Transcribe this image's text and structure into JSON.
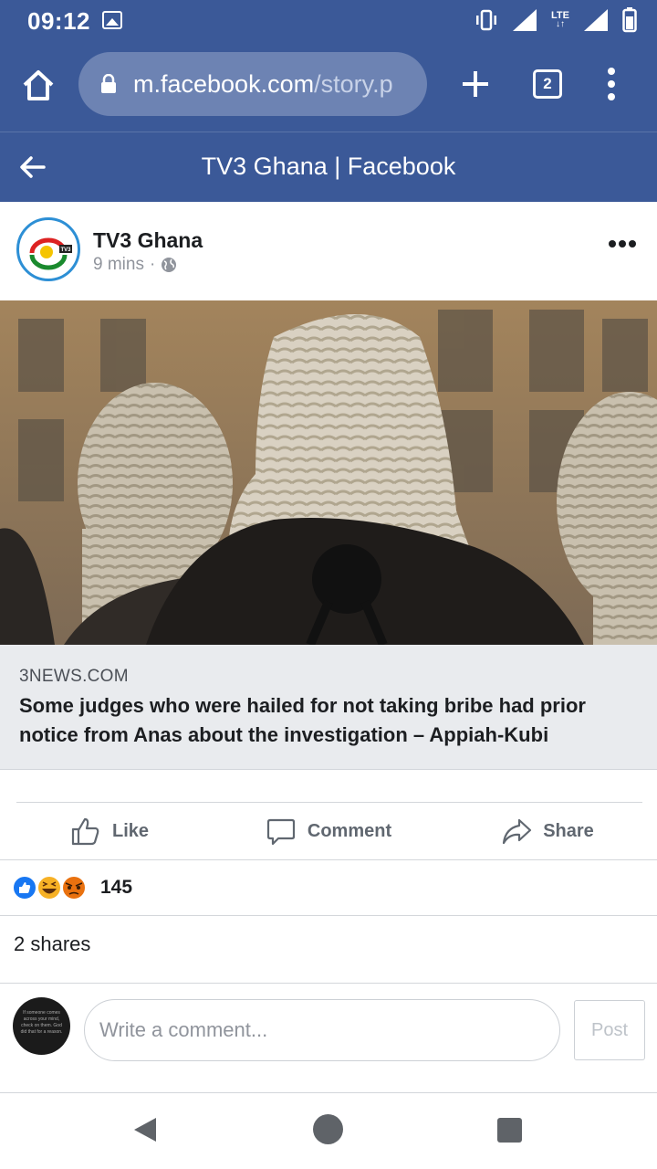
{
  "status_bar": {
    "time": "09:12",
    "network_label": "LTE",
    "icons": [
      "image-icon",
      "vibrate-icon",
      "signal-icon",
      "lte-signal-icon",
      "battery-icon"
    ]
  },
  "browser": {
    "url_domain": "m.facebook.com",
    "url_path": "/story.p",
    "tab_count": "2",
    "icons": [
      "home-icon",
      "lock-icon",
      "plus-icon",
      "tabs-icon",
      "overflow-menu-icon"
    ]
  },
  "header": {
    "title": "TV3 Ghana | Facebook",
    "back_icon": "arrow-left-icon"
  },
  "post": {
    "page_name": "TV3 Ghana",
    "time_ago": "9 mins",
    "separator": "·",
    "privacy_icon": "globe-icon",
    "more_icon": "more-dots-icon",
    "avatar_logo_text": "TV3",
    "image_desc_icon": "photo",
    "link": {
      "domain": "3NEWS.COM",
      "title": "Some judges who were hailed for not taking bribe had prior notice from Anas about the investigation – Appiah-Kubi"
    }
  },
  "actions": {
    "like": "Like",
    "comment": "Comment",
    "share": "Share"
  },
  "reactions": {
    "count": "145",
    "types": [
      "like",
      "haha",
      "angry"
    ]
  },
  "shares": {
    "text": "2 shares"
  },
  "composer": {
    "placeholder": "Write a comment...",
    "post_label": "Post",
    "avatar_text": "If someone comes across your mind, check on them. God did that for a reason."
  },
  "colors": {
    "facebook_blue": "#3b5998",
    "url_pill": "#6d83b3",
    "link_bg": "#e9ebee",
    "muted_text": "#90949c"
  }
}
